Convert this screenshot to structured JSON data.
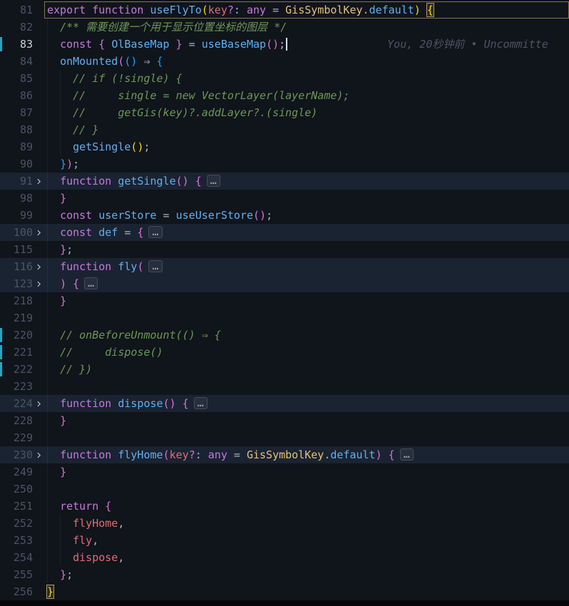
{
  "colors": {
    "bg": "#10141b",
    "txt": "#abb2bf",
    "kw": "#c678dd",
    "fn": "#61afef",
    "var": "#61afef",
    "ref": "#e06c75",
    "cls": "#e5c07b",
    "prop": "#61afef",
    "param": "#e06c75",
    "cmt": "#6a9955",
    "b1": "#ffd700",
    "b2": "#da70d6",
    "b3": "#179fff",
    "num": "#4b5565",
    "num_active": "#ccd2dd",
    "blame": "#4c5564",
    "change": "#1fa8c4",
    "cursor": "#d7dde8",
    "chevron": "#c5cbd3",
    "bottom": "#05070b"
  },
  "editor": {
    "blame_text": "You, 20秒钟前 • Uncommitte",
    "lines": [
      {
        "n": 81,
        "outlined": true,
        "guides": [],
        "tokens": [
          {
            "t": "export",
            "c": "kw"
          },
          {
            "t": " ",
            "c": "txt"
          },
          {
            "t": "function",
            "c": "kw"
          },
          {
            "t": " ",
            "c": "txt"
          },
          {
            "t": "useFlyTo",
            "c": "fn"
          },
          {
            "t": "(",
            "c": "b1"
          },
          {
            "t": "key",
            "c": "param"
          },
          {
            "t": "?",
            "c": "kw"
          },
          {
            "t": ": ",
            "c": "txt"
          },
          {
            "t": "any",
            "c": "kw"
          },
          {
            "t": " = ",
            "c": "txt"
          },
          {
            "t": "GisSymbolKey",
            "c": "cls"
          },
          {
            "t": ".",
            "c": "txt"
          },
          {
            "t": "default",
            "c": "prop"
          },
          {
            "t": ")",
            "c": "b1"
          },
          {
            "t": " ",
            "c": "txt"
          },
          {
            "t": "{",
            "c": "b1",
            "bm": true
          }
        ]
      },
      {
        "n": 82,
        "guides": [
          0
        ],
        "tokens": [
          {
            "t": "  ",
            "c": "txt"
          },
          {
            "t": "/** 需要创建一个用于显示位置坐标的图层 */",
            "c": "cmt"
          }
        ]
      },
      {
        "n": 83,
        "active": true,
        "changed": true,
        "cursor": true,
        "blame": true,
        "guides": [
          0
        ],
        "tokens": [
          {
            "t": "  ",
            "c": "txt"
          },
          {
            "t": "const",
            "c": "kw"
          },
          {
            "t": " ",
            "c": "txt"
          },
          {
            "t": "{",
            "c": "b2"
          },
          {
            "t": " ",
            "c": "txt"
          },
          {
            "t": "OlBaseMap",
            "c": "var"
          },
          {
            "t": " ",
            "c": "txt"
          },
          {
            "t": "}",
            "c": "b2"
          },
          {
            "t": " = ",
            "c": "txt"
          },
          {
            "t": "useBaseMap",
            "c": "fn"
          },
          {
            "t": "(",
            "c": "b2"
          },
          {
            "t": ")",
            "c": "b2"
          },
          {
            "t": ";",
            "c": "txt"
          }
        ]
      },
      {
        "n": 84,
        "guides": [
          0
        ],
        "tokens": [
          {
            "t": "  ",
            "c": "txt"
          },
          {
            "t": "onMounted",
            "c": "fn"
          },
          {
            "t": "(",
            "c": "b2"
          },
          {
            "t": "(",
            "c": "b3"
          },
          {
            "t": ")",
            "c": "b3"
          },
          {
            "t": " ⇒ ",
            "c": "txt"
          },
          {
            "t": "{",
            "c": "b3"
          }
        ]
      },
      {
        "n": 85,
        "guides": [
          0,
          1
        ],
        "tokens": [
          {
            "t": "    ",
            "c": "txt"
          },
          {
            "t": "// if (!single) {",
            "c": "cmt"
          }
        ]
      },
      {
        "n": 86,
        "guides": [
          0,
          1
        ],
        "tokens": [
          {
            "t": "    ",
            "c": "txt"
          },
          {
            "t": "//     single = new VectorLayer(layerName);",
            "c": "cmt"
          }
        ]
      },
      {
        "n": 87,
        "guides": [
          0,
          1
        ],
        "tokens": [
          {
            "t": "    ",
            "c": "txt"
          },
          {
            "t": "//     getGis(key)?.addLayer?.(single)",
            "c": "cmt"
          }
        ]
      },
      {
        "n": 88,
        "guides": [
          0,
          1
        ],
        "tokens": [
          {
            "t": "    ",
            "c": "txt"
          },
          {
            "t": "// }",
            "c": "cmt"
          }
        ]
      },
      {
        "n": 89,
        "guides": [
          0,
          1
        ],
        "tokens": [
          {
            "t": "    ",
            "c": "txt"
          },
          {
            "t": "getSingle",
            "c": "fn"
          },
          {
            "t": "(",
            "c": "b1"
          },
          {
            "t": ")",
            "c": "b1"
          },
          {
            "t": ";",
            "c": "txt"
          }
        ]
      },
      {
        "n": 90,
        "guides": [
          0
        ],
        "tokens": [
          {
            "t": "  ",
            "c": "txt"
          },
          {
            "t": "}",
            "c": "b3"
          },
          {
            "t": ")",
            "c": "b2"
          },
          {
            "t": ";",
            "c": "txt"
          }
        ]
      },
      {
        "n": 91,
        "fold_icon": true,
        "folded": true,
        "guides": [
          0
        ],
        "tokens": [
          {
            "t": "  ",
            "c": "txt"
          },
          {
            "t": "function",
            "c": "kw"
          },
          {
            "t": " ",
            "c": "txt"
          },
          {
            "t": "getSingle",
            "c": "fn"
          },
          {
            "t": "(",
            "c": "b2"
          },
          {
            "t": ")",
            "c": "b2"
          },
          {
            "t": " ",
            "c": "txt"
          },
          {
            "t": "{",
            "c": "b2"
          },
          {
            "t": "…",
            "c": "fold"
          }
        ]
      },
      {
        "n": 98,
        "guides": [
          0
        ],
        "tokens": [
          {
            "t": "  ",
            "c": "txt"
          },
          {
            "t": "}",
            "c": "b2"
          }
        ]
      },
      {
        "n": 99,
        "guides": [
          0
        ],
        "tokens": [
          {
            "t": "  ",
            "c": "txt"
          },
          {
            "t": "const",
            "c": "kw"
          },
          {
            "t": " ",
            "c": "txt"
          },
          {
            "t": "userStore",
            "c": "var"
          },
          {
            "t": " = ",
            "c": "txt"
          },
          {
            "t": "useUserStore",
            "c": "fn"
          },
          {
            "t": "(",
            "c": "b2"
          },
          {
            "t": ")",
            "c": "b2"
          },
          {
            "t": ";",
            "c": "txt"
          }
        ]
      },
      {
        "n": 100,
        "fold_icon": true,
        "folded": true,
        "guides": [
          0
        ],
        "tokens": [
          {
            "t": "  ",
            "c": "txt"
          },
          {
            "t": "const",
            "c": "kw"
          },
          {
            "t": " ",
            "c": "txt"
          },
          {
            "t": "def",
            "c": "var"
          },
          {
            "t": " = ",
            "c": "txt"
          },
          {
            "t": "{",
            "c": "b2"
          },
          {
            "t": "…",
            "c": "fold"
          }
        ]
      },
      {
        "n": 115,
        "guides": [
          0
        ],
        "tokens": [
          {
            "t": "  ",
            "c": "txt"
          },
          {
            "t": "}",
            "c": "b2"
          },
          {
            "t": ";",
            "c": "txt"
          }
        ]
      },
      {
        "n": 116,
        "fold_icon": true,
        "folded": true,
        "guides": [
          0
        ],
        "tokens": [
          {
            "t": "  ",
            "c": "txt"
          },
          {
            "t": "function",
            "c": "kw"
          },
          {
            "t": " ",
            "c": "txt"
          },
          {
            "t": "fly",
            "c": "fn"
          },
          {
            "t": "(",
            "c": "b2"
          },
          {
            "t": "…",
            "c": "fold"
          }
        ]
      },
      {
        "n": 123,
        "fold_icon": true,
        "folded": true,
        "guides": [
          0
        ],
        "tokens": [
          {
            "t": "  ",
            "c": "txt"
          },
          {
            "t": ")",
            "c": "b2"
          },
          {
            "t": " ",
            "c": "txt"
          },
          {
            "t": "{",
            "c": "b2"
          },
          {
            "t": "…",
            "c": "fold"
          }
        ]
      },
      {
        "n": 218,
        "guides": [
          0
        ],
        "tokens": [
          {
            "t": "  ",
            "c": "txt"
          },
          {
            "t": "}",
            "c": "b2"
          }
        ]
      },
      {
        "n": 219,
        "guides": [
          0
        ],
        "tokens": []
      },
      {
        "n": 220,
        "changed": true,
        "guides": [
          0
        ],
        "tokens": [
          {
            "t": "  ",
            "c": "txt"
          },
          {
            "t": "// onBeforeUnmount(() ⇒ {",
            "c": "cmt"
          }
        ]
      },
      {
        "n": 221,
        "changed": true,
        "guides": [
          0
        ],
        "tokens": [
          {
            "t": "  ",
            "c": "txt"
          },
          {
            "t": "//     dispose()",
            "c": "cmt"
          }
        ]
      },
      {
        "n": 222,
        "changed": true,
        "guides": [
          0
        ],
        "tokens": [
          {
            "t": "  ",
            "c": "txt"
          },
          {
            "t": "// })",
            "c": "cmt"
          }
        ]
      },
      {
        "n": 223,
        "guides": [
          0
        ],
        "tokens": []
      },
      {
        "n": 224,
        "fold_icon": true,
        "folded": true,
        "guides": [
          0
        ],
        "tokens": [
          {
            "t": "  ",
            "c": "txt"
          },
          {
            "t": "function",
            "c": "kw"
          },
          {
            "t": " ",
            "c": "txt"
          },
          {
            "t": "dispose",
            "c": "fn"
          },
          {
            "t": "(",
            "c": "b2"
          },
          {
            "t": ")",
            "c": "b2"
          },
          {
            "t": " ",
            "c": "txt"
          },
          {
            "t": "{",
            "c": "b2"
          },
          {
            "t": "…",
            "c": "fold"
          }
        ]
      },
      {
        "n": 228,
        "guides": [
          0
        ],
        "tokens": [
          {
            "t": "  ",
            "c": "txt"
          },
          {
            "t": "}",
            "c": "b2"
          }
        ]
      },
      {
        "n": 229,
        "guides": [
          0
        ],
        "tokens": []
      },
      {
        "n": 230,
        "fold_icon": true,
        "folded": true,
        "guides": [
          0
        ],
        "tokens": [
          {
            "t": "  ",
            "c": "txt"
          },
          {
            "t": "function",
            "c": "kw"
          },
          {
            "t": " ",
            "c": "txt"
          },
          {
            "t": "flyHome",
            "c": "fn"
          },
          {
            "t": "(",
            "c": "b2"
          },
          {
            "t": "key",
            "c": "param"
          },
          {
            "t": "?",
            "c": "kw"
          },
          {
            "t": ": ",
            "c": "txt"
          },
          {
            "t": "any",
            "c": "kw"
          },
          {
            "t": " = ",
            "c": "txt"
          },
          {
            "t": "GisSymbolKey",
            "c": "cls"
          },
          {
            "t": ".",
            "c": "txt"
          },
          {
            "t": "default",
            "c": "prop"
          },
          {
            "t": ")",
            "c": "b2"
          },
          {
            "t": " ",
            "c": "txt"
          },
          {
            "t": "{",
            "c": "b2"
          },
          {
            "t": "…",
            "c": "fold"
          }
        ]
      },
      {
        "n": 249,
        "guides": [
          0
        ],
        "tokens": [
          {
            "t": "  ",
            "c": "txt"
          },
          {
            "t": "}",
            "c": "b2"
          }
        ]
      },
      {
        "n": 250,
        "guides": [
          0
        ],
        "tokens": []
      },
      {
        "n": 251,
        "guides": [
          0
        ],
        "tokens": [
          {
            "t": "  ",
            "c": "txt"
          },
          {
            "t": "return",
            "c": "kw"
          },
          {
            "t": " ",
            "c": "txt"
          },
          {
            "t": "{",
            "c": "b2"
          }
        ]
      },
      {
        "n": 252,
        "guides": [
          0,
          1
        ],
        "tokens": [
          {
            "t": "    ",
            "c": "txt"
          },
          {
            "t": "flyHome",
            "c": "ref"
          },
          {
            "t": ",",
            "c": "txt"
          }
        ]
      },
      {
        "n": 253,
        "guides": [
          0,
          1
        ],
        "tokens": [
          {
            "t": "    ",
            "c": "txt"
          },
          {
            "t": "fly",
            "c": "ref"
          },
          {
            "t": ",",
            "c": "txt"
          }
        ]
      },
      {
        "n": 254,
        "guides": [
          0,
          1
        ],
        "tokens": [
          {
            "t": "    ",
            "c": "txt"
          },
          {
            "t": "dispose",
            "c": "ref"
          },
          {
            "t": ",",
            "c": "txt"
          }
        ]
      },
      {
        "n": 255,
        "guides": [
          0
        ],
        "tokens": [
          {
            "t": "  ",
            "c": "txt"
          },
          {
            "t": "}",
            "c": "b2"
          },
          {
            "t": ";",
            "c": "txt"
          }
        ]
      },
      {
        "n": 256,
        "guides": [],
        "tokens": [
          {
            "t": "}",
            "c": "b1",
            "bm": true
          }
        ]
      }
    ]
  }
}
